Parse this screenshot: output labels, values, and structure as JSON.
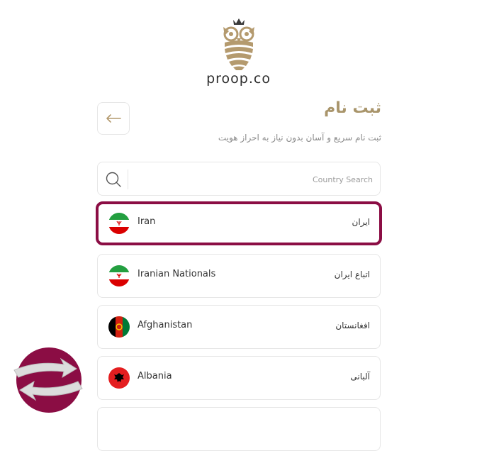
{
  "brand": {
    "name": "proop.co"
  },
  "header": {
    "title": "ثبت نام",
    "subtitle": "ثبت نام سریع و آسان بدون نیاز به احراز هویت"
  },
  "search": {
    "placeholder": "Country Search"
  },
  "countries": [
    {
      "en": "Iran",
      "fa": "ایران",
      "selected": true
    },
    {
      "en": "Iranian Nationals",
      "fa": "اتباع ایران",
      "selected": false
    },
    {
      "en": "Afghanistan",
      "fa": "افغانستان",
      "selected": false
    },
    {
      "en": "Albania",
      "fa": "آلبانی",
      "selected": false
    }
  ],
  "colors": {
    "accent_gold": "#a9956b",
    "selected_border": "#8b0d44"
  },
  "icons": [
    "owl-logo-icon",
    "arrow-left-icon",
    "search-icon",
    "refresh-widget-icon"
  ]
}
